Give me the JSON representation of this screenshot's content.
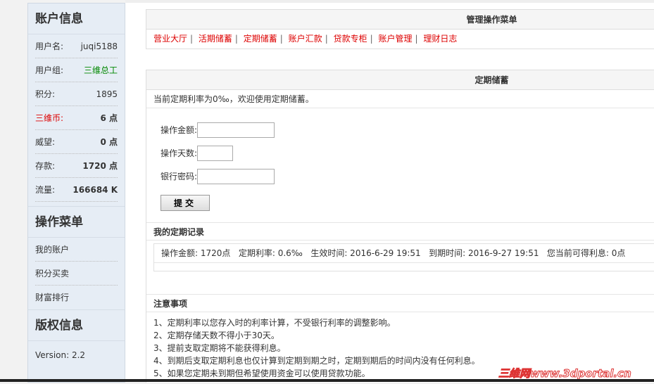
{
  "sidebar": {
    "account_title": "账户信息",
    "rows": [
      {
        "label": "用户名:",
        "value": "juqi5188"
      },
      {
        "label": "用户组:",
        "value": "三维总工"
      },
      {
        "label": "积分:",
        "value": "1895"
      },
      {
        "label": "三维币:",
        "value": "6 点"
      },
      {
        "label": "威望:",
        "value": "0 点"
      },
      {
        "label": "存款:",
        "value": "1720 点"
      },
      {
        "label": "流量:",
        "value": "166684 K"
      }
    ],
    "menu_title": "操作菜单",
    "menu": [
      "我的账户",
      "积分买卖",
      "财富排行"
    ],
    "copyright_title": "版权信息",
    "version": "Version: 2.2"
  },
  "nav": {
    "title": "管理操作菜单",
    "links": [
      "营业大厅",
      "活期储蓄",
      "定期储蓄",
      "账户汇款",
      "贷款专柜",
      "账户管理",
      "理财日志"
    ],
    "sep": "|"
  },
  "deposit": {
    "title": "定期储蓄",
    "intro": "当前定期利率为0‰，欢迎使用定期储蓄。",
    "amount_label": "操作金额:",
    "days_label": "操作天数:",
    "password_label": "银行密码:",
    "submit": "提交",
    "records_title": "我的定期记录",
    "record": "操作金额: 1720点   定期利率: 0.6‰   生效时间: 2016-6-29 19:51   到期时间: 2016-9-27 19:51   您当前可得利息: 0点",
    "notes_title": "注意事项",
    "notes": [
      "1、定期利率以您存入时的利率计算，不受银行利率的调整影响。",
      "2、定期存储天数不得小于30天。",
      "3、提前支取定期将不能获得利息。",
      "4、到期后支取定期利息也仅计算到定期到期之时，定期到期后的时间内没有任何利息。",
      "5、如果您定期未到期但希望使用资金可以使用贷款功能。"
    ]
  },
  "watermark": "三维网www.3dportal.cn"
}
